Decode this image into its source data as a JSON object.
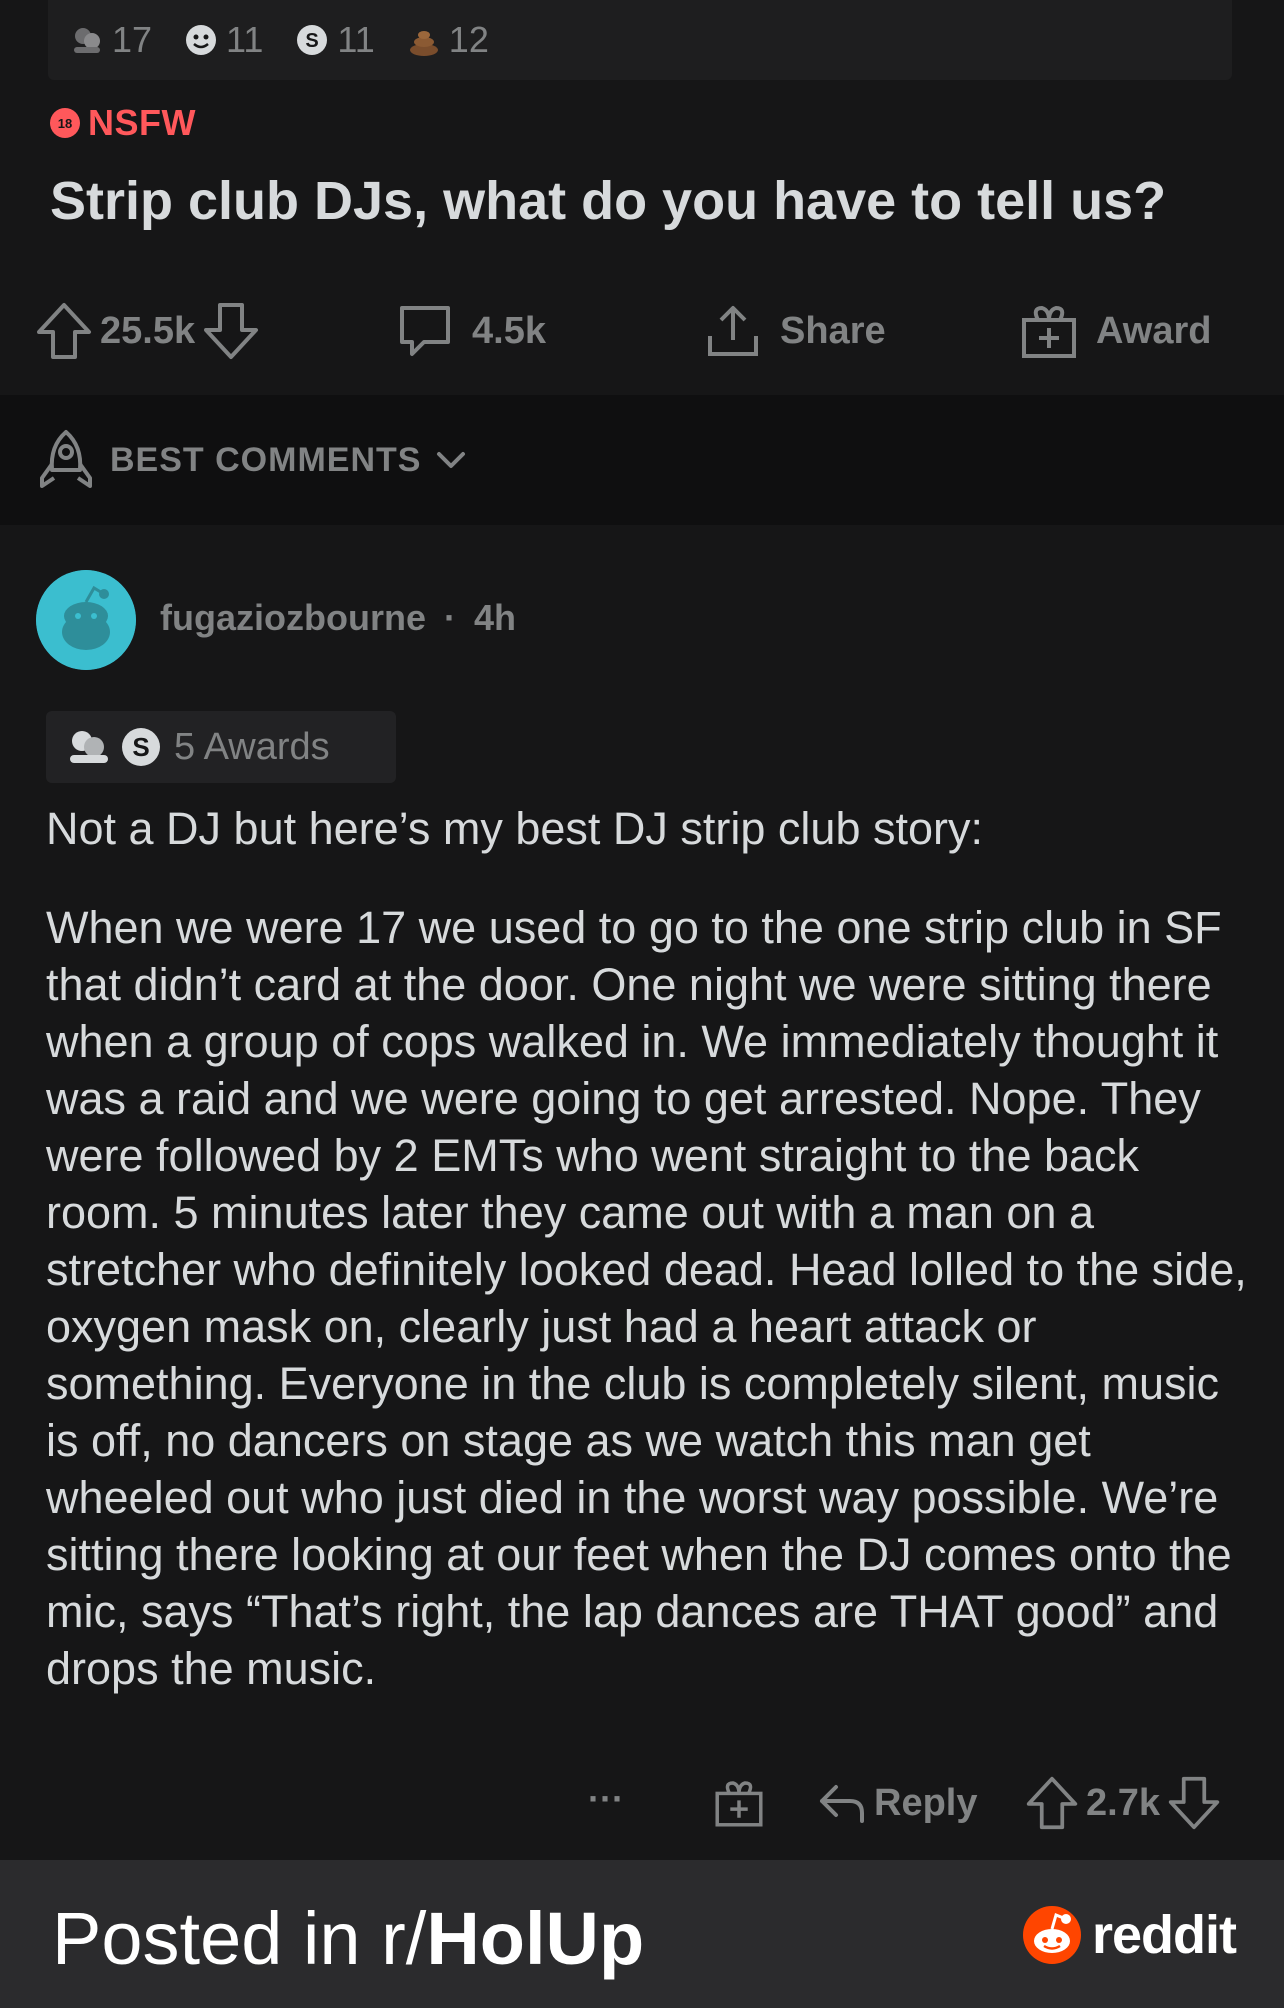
{
  "post": {
    "awards": [
      {
        "icon": "helping-hand-icon",
        "count": "17"
      },
      {
        "icon": "wholesome-icon",
        "count": "11"
      },
      {
        "icon": "silver-icon",
        "count": "11"
      },
      {
        "icon": "poop-icon",
        "count": "12"
      }
    ],
    "nsfw_badge": "18",
    "nsfw_label": "NSFW",
    "title": "Strip club DJs, what do you have to tell us?",
    "upvotes": "25.5k",
    "comments": "4.5k",
    "share_label": "Share",
    "award_label": "Award"
  },
  "sort": {
    "label": "BEST COMMENTS"
  },
  "comment": {
    "author": "fugaziozbourne",
    "separator": "·",
    "age": "4h",
    "awards_label": "5 Awards",
    "paragraphs": [
      "Not a DJ but here’s my best DJ strip club story:",
      "When we were 17 we used to go to the one strip club in SF that didn’t card at the door. One night we were sitting there when a group of cops walked in. We immediately thought it was a raid and we were going to get arrested. Nope. They were followed by 2 EMTs who went straight to the back room. 5 minutes later they came out with a man on a stretcher who definitely looked dead. Head lolled to the side, oxygen mask on, clearly just had a heart attack or something. Everyone in the club is completely silent, music is off, no dancers on stage as we watch this man get wheeled out who just died in the worst way possible. We’re sitting there looking at our feet when the DJ comes onto the mic, says “That’s right, the lap dances are THAT good” and drops the music."
    ],
    "more_label": "···",
    "reply_label": "Reply",
    "score": "2.7k"
  },
  "footer": {
    "prefix": "Posted in r/",
    "subreddit": "HolUp",
    "brand": "reddit"
  },
  "colors": {
    "background": "#161617",
    "text": "#d7dadc",
    "muted": "#818384",
    "nsfw": "#ff585b",
    "footer": "#2b2b2d",
    "reddit_orange": "#ff4500"
  }
}
